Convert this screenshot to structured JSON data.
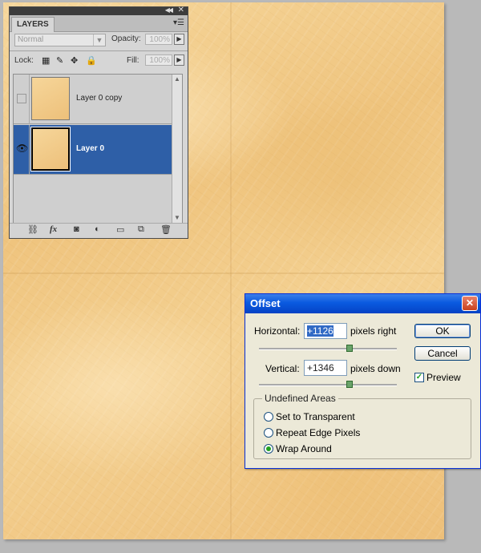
{
  "layers_panel": {
    "tab_label": "LAYERS",
    "blend_mode": "Normal",
    "opacity_label": "Opacity:",
    "opacity_value": "100%",
    "lock_label": "Lock:",
    "fill_label": "Fill:",
    "fill_value": "100%",
    "layers": [
      {
        "name": "Layer 0 copy",
        "visible": false,
        "selected": false
      },
      {
        "name": "Layer 0",
        "visible": true,
        "selected": true
      }
    ],
    "bottom_icons": [
      "link-icon",
      "fx-icon",
      "mask-icon",
      "adjustment-icon",
      "folder-icon",
      "new-layer-icon",
      "trash-icon"
    ],
    "fx_label": "fx"
  },
  "offset_dialog": {
    "title": "Offset",
    "horizontal_label": "Horizontal:",
    "horizontal_value": "+1126",
    "horizontal_unit": "pixels right",
    "vertical_label": "Vertical:",
    "vertical_value": "+1346",
    "vertical_unit": "pixels down",
    "ok_label": "OK",
    "cancel_label": "Cancel",
    "preview_label": "Preview",
    "preview_checked": true,
    "group_label": "Undefined Areas",
    "options": [
      {
        "label": "Set to Transparent",
        "selected": false
      },
      {
        "label": "Repeat Edge Pixels",
        "selected": false
      },
      {
        "label": "Wrap Around",
        "selected": true
      }
    ]
  },
  "colors": {
    "selection_blue": "#2e5fa7",
    "titlebar_blue": "#0a5ae0",
    "parchment": "#f2cb88"
  }
}
